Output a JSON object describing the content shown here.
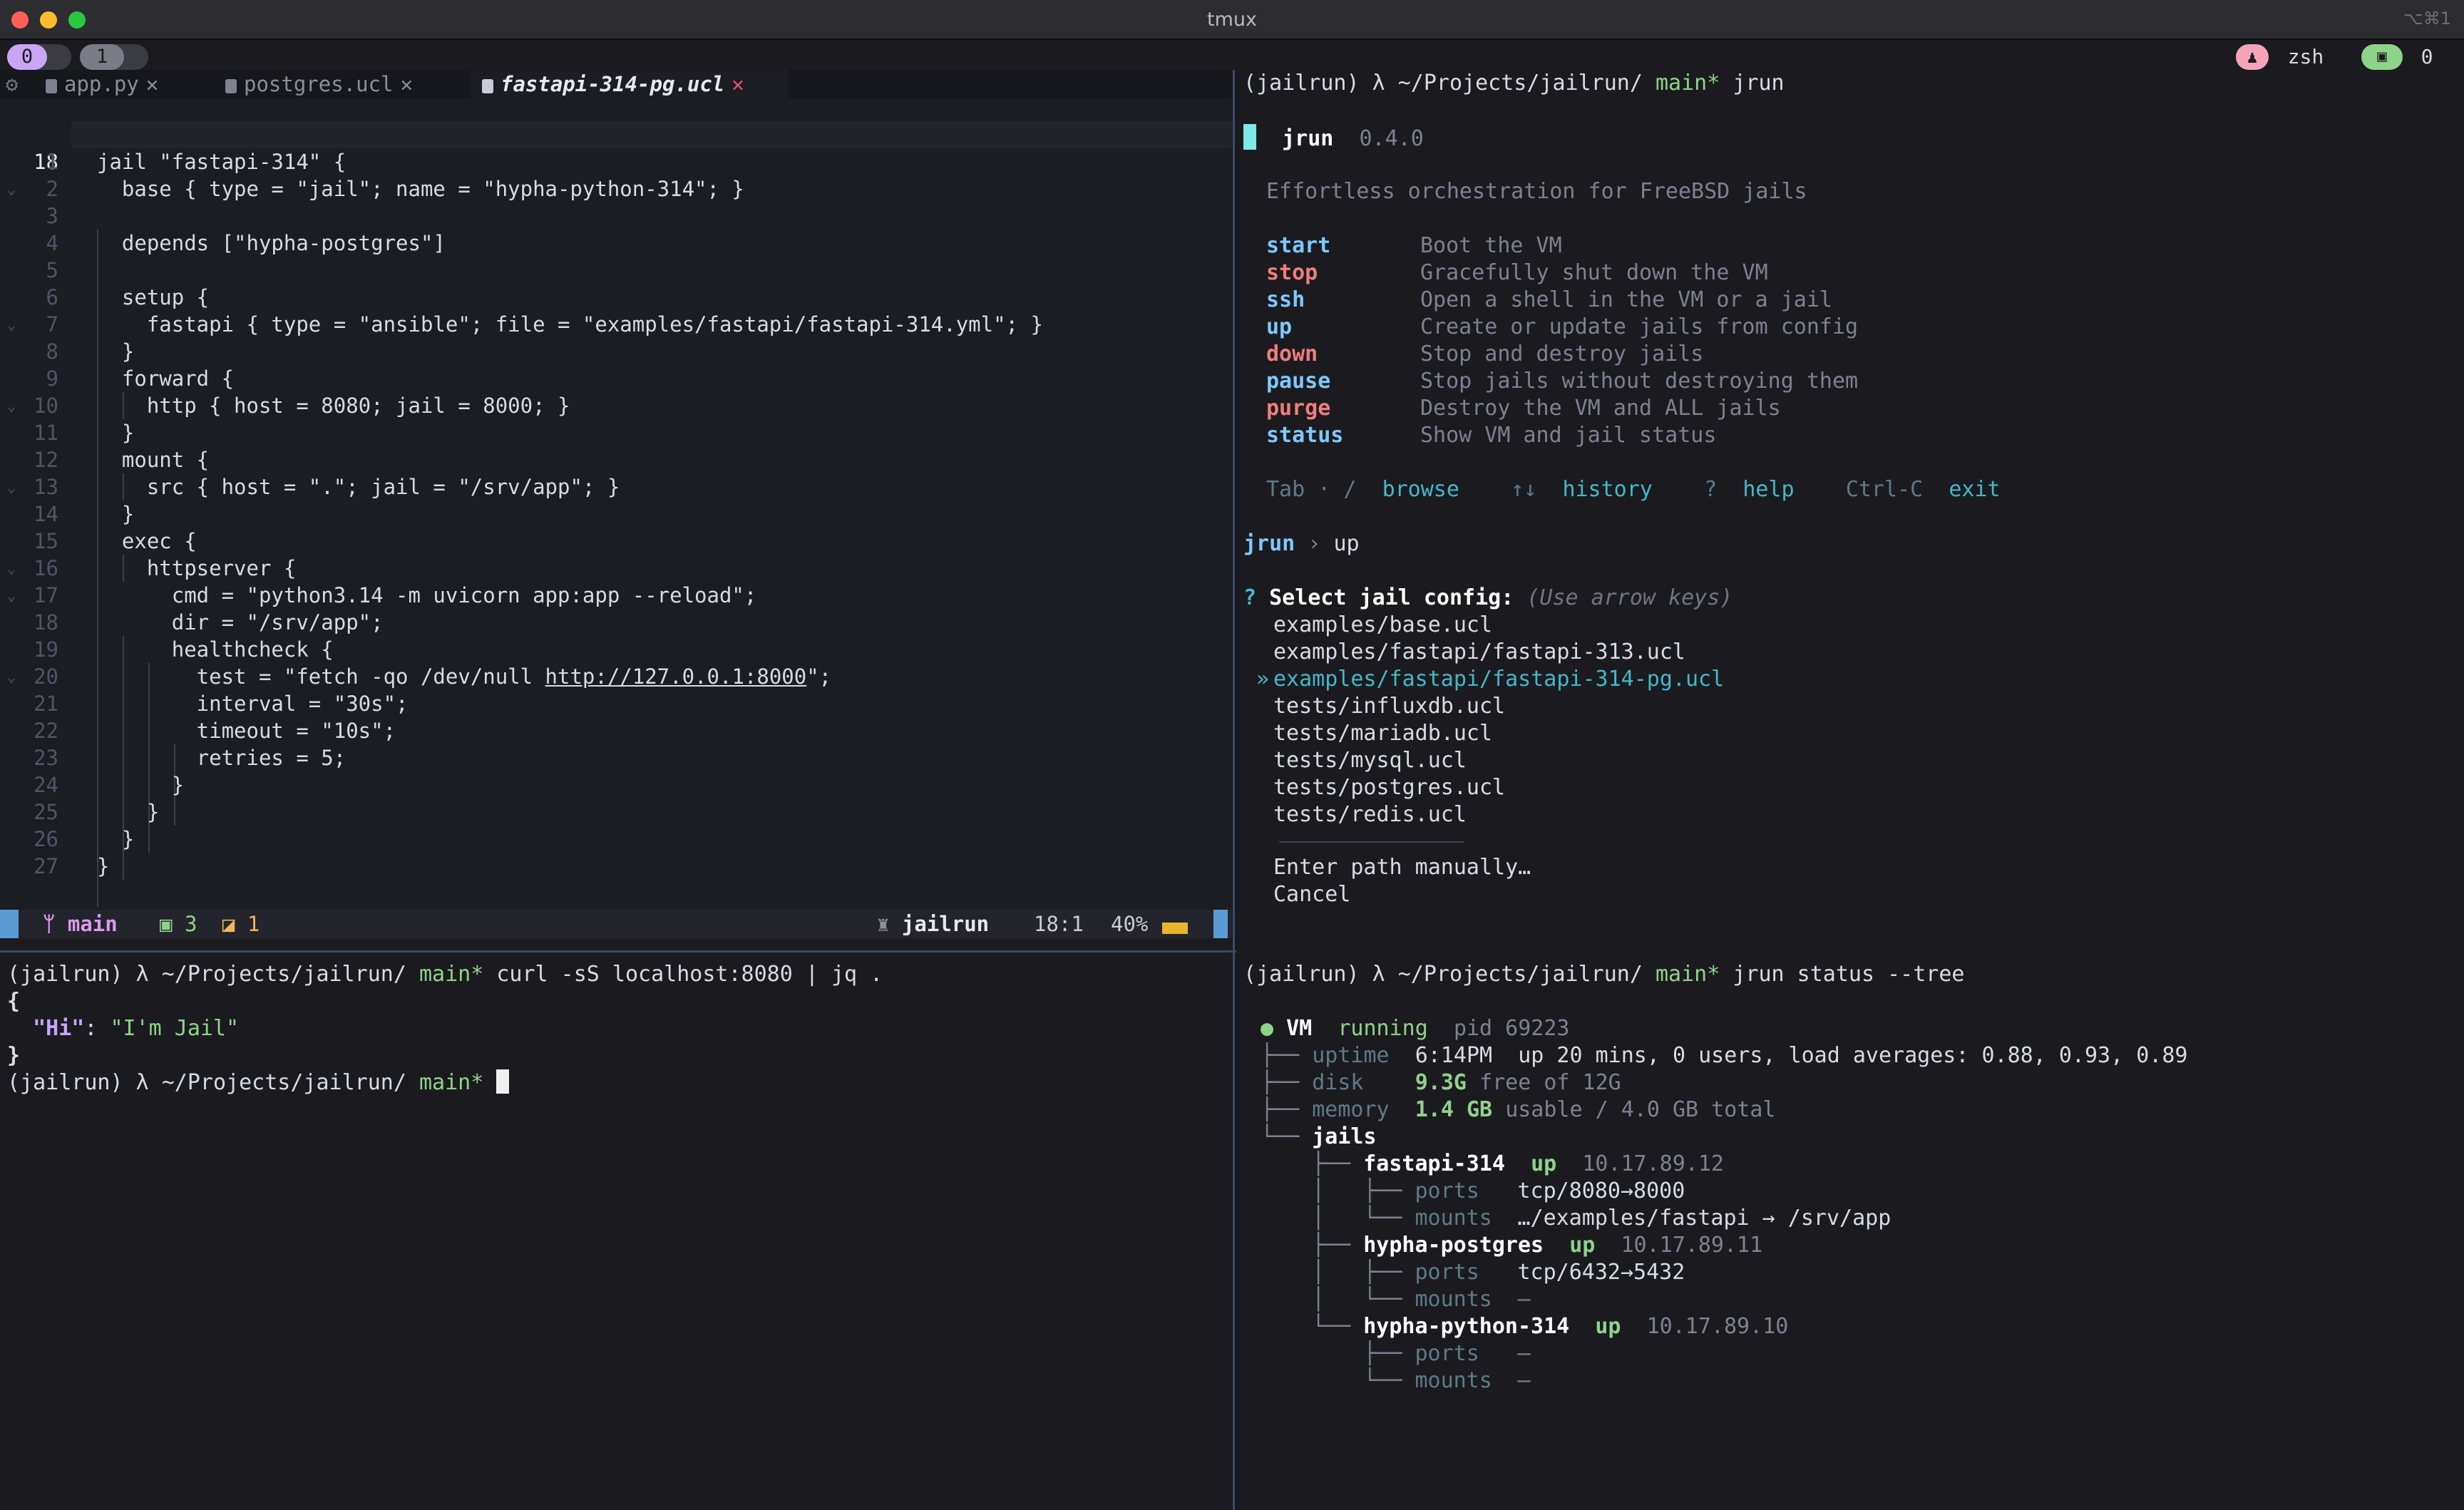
{
  "window": {
    "title": "tmux",
    "shortcut": "⌥⌘1"
  },
  "tmux": {
    "windows": [
      {
        "index": "0",
        "active": true
      },
      {
        "index": "1",
        "active": false
      }
    ],
    "right": {
      "person_icon": "person-icon",
      "shell": "zsh",
      "term_icon": "terminal-icon",
      "session_num": "0"
    }
  },
  "editor": {
    "tabs": [
      {
        "label": "app.py",
        "close": "✕",
        "active": false
      },
      {
        "label": "postgres.ucl",
        "close": "✕",
        "active": false
      },
      {
        "label": "fastapi-314-pg.ucl",
        "close": "✕",
        "active": true
      }
    ],
    "current_line_number": "18",
    "lines": [
      {
        "n": "1",
        "fold": "",
        "text": "jail \"fastapi-314\" {"
      },
      {
        "n": "2",
        "fold": "⌄",
        "text": "  base { type = \"jail\"; name = \"hypha-python-314\"; }"
      },
      {
        "n": "3",
        "fold": "",
        "text": ""
      },
      {
        "n": "4",
        "fold": "",
        "text": "  depends [\"hypha-postgres\"]"
      },
      {
        "n": "5",
        "fold": "",
        "text": ""
      },
      {
        "n": "6",
        "fold": "",
        "text": "  setup {"
      },
      {
        "n": "7",
        "fold": "⌄",
        "text": "    fastapi { type = \"ansible\"; file = \"examples/fastapi/fastapi-314.yml\"; }"
      },
      {
        "n": "8",
        "fold": "",
        "text": "  }"
      },
      {
        "n": "9",
        "fold": "",
        "text": "  forward {"
      },
      {
        "n": "10",
        "fold": "⌄",
        "text": "    http { host = 8080; jail = 8000; }"
      },
      {
        "n": "11",
        "fold": "",
        "text": "  }"
      },
      {
        "n": "12",
        "fold": "",
        "text": "  mount {"
      },
      {
        "n": "13",
        "fold": "⌄",
        "text": "    src { host = \".\"; jail = \"/srv/app\"; }"
      },
      {
        "n": "14",
        "fold": "",
        "text": "  }"
      },
      {
        "n": "15",
        "fold": "",
        "text": "  exec {"
      },
      {
        "n": "16",
        "fold": "⌄",
        "text": "    httpserver {"
      },
      {
        "n": "17",
        "fold": "⌄",
        "text": "      cmd = \"python3.14 -m uvicorn app:app --reload\";"
      },
      {
        "n": "18",
        "fold": "",
        "text": "      dir = \"/srv/app\";"
      },
      {
        "n": "19",
        "fold": "",
        "text": "      healthcheck {"
      },
      {
        "n": "20",
        "fold": "⌄",
        "text_pre": "        test = \"fetch -qo /dev/null ",
        "text_url": "http://127.0.0.1:8000",
        "text_post": "\";"
      },
      {
        "n": "21",
        "fold": "",
        "text": "        interval = \"30s\";"
      },
      {
        "n": "22",
        "fold": "",
        "text": "        timeout = \"10s\";"
      },
      {
        "n": "23",
        "fold": "",
        "text": "        retries = 5;"
      },
      {
        "n": "24",
        "fold": "",
        "text": "      }"
      },
      {
        "n": "25",
        "fold": "",
        "text": "    }"
      },
      {
        "n": "26",
        "fold": "",
        "text": "  }"
      },
      {
        "n": "27",
        "fold": "",
        "text": "}"
      }
    ],
    "statusline": {
      "branch": "main",
      "added": "3",
      "modified": "1",
      "user": "jailrun",
      "position": "18:1",
      "percent": "40%"
    }
  },
  "prompt": {
    "env": "(jailrun)",
    "lambda": "λ",
    "path": "~/Projects/jailrun/",
    "branch": "main*"
  },
  "jrun_top": {
    "command": "jrun",
    "app_name": "jrun",
    "version": "0.4.0",
    "tagline": "Effortless orchestration for FreeBSD jails",
    "commands": [
      {
        "name": "start",
        "desc": "Boot the VM",
        "color": "#7ec8ff"
      },
      {
        "name": "stop",
        "desc": "Gracefully shut down the VM",
        "color": "#ef7d7d"
      },
      {
        "name": "ssh",
        "desc": "Open a shell in the VM or a jail",
        "color": "#7ec8ff"
      },
      {
        "name": "up",
        "desc": "Create or update jails from config",
        "color": "#7ec8ff"
      },
      {
        "name": "down",
        "desc": "Stop and destroy jails",
        "color": "#ef7d7d"
      },
      {
        "name": "pause",
        "desc": "Stop jails without destroying them",
        "color": "#7ec8ff"
      },
      {
        "name": "purge",
        "desc": "Destroy the VM and ALL jails",
        "color": "#ef7d7d"
      },
      {
        "name": "status",
        "desc": "Show VM and jail status",
        "color": "#7ec8ff"
      }
    ],
    "hints": {
      "tab": "Tab · /",
      "browse": "browse",
      "arrows": "↑↓",
      "history": "history",
      "q": "?",
      "help": "help",
      "ctrlc": "Ctrl-C",
      "exit": "exit"
    },
    "breadcrumb_root": "jrun",
    "breadcrumb_sep": "›",
    "breadcrumb_cmd": "up",
    "question_mark": "?",
    "question": "Select jail config:",
    "question_hint": "(Use arrow keys)",
    "selected_marker": "»",
    "options": [
      "examples/base.ucl",
      "examples/fastapi/fastapi-313.ucl",
      "examples/fastapi/fastapi-314-pg.ucl",
      "tests/influxdb.ucl",
      "tests/mariadb.ucl",
      "tests/mysql.ucl",
      "tests/postgres.ucl",
      "tests/redis.ucl"
    ],
    "selected_index": 2,
    "extra_options": [
      "Enter path manually…",
      "Cancel"
    ]
  },
  "shell_bl": {
    "command": "curl -sS localhost:8080 | jq .",
    "json_open": "{",
    "json_key": "\"Hi\"",
    "json_colon": ":",
    "json_val": "\"I'm Jail\"",
    "json_close": "}"
  },
  "jrun_status": {
    "command": "jrun status --tree",
    "vm_dot": "●",
    "vm_label": "VM",
    "vm_state": "running",
    "vm_pid": "pid 69223",
    "uptime_label": "uptime",
    "uptime_value": "6:14PM  up 20 mins, 0 users, load averages: 0.88, 0.93, 0.89",
    "disk_label": "disk",
    "disk_value": "9.3G",
    "disk_rest": "free of 12G",
    "memory_label": "memory",
    "memory_value": "1.4 GB",
    "memory_rest": "usable / 4.0 GB total",
    "jails_label": "jails",
    "jails": [
      {
        "name": "fastapi-314",
        "state": "up",
        "ip": "10.17.89.12",
        "ports": "tcp/8080→8000",
        "mounts": "…/examples/fastapi → /srv/app"
      },
      {
        "name": "hypha-postgres",
        "state": "up",
        "ip": "10.17.89.11",
        "ports": "tcp/6432→5432",
        "mounts": "—"
      },
      {
        "name": "hypha-python-314",
        "state": "up",
        "ip": "10.17.89.10",
        "ports": "—",
        "mounts": "—"
      }
    ],
    "ports_label": "ports",
    "mounts_label": "mounts"
  },
  "colors": {
    "accent_green": "#8fd28a",
    "accent_cyan": "#43b8c9",
    "accent_red": "#ef7d7d",
    "accent_blue": "#7ec8ff",
    "branch_purple": "#d99be8"
  }
}
